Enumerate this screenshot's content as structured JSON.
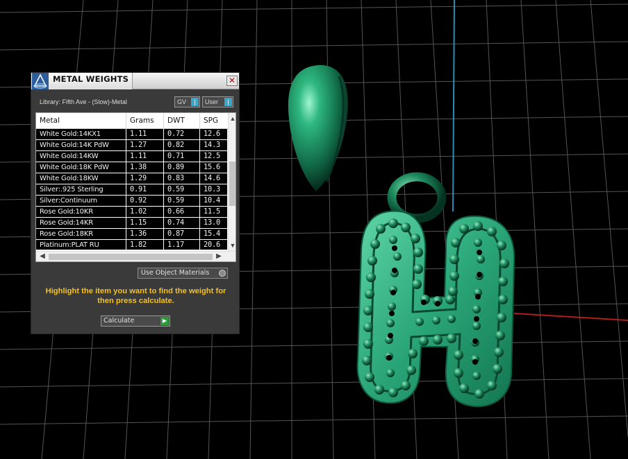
{
  "panel": {
    "title": "METAL WEIGHTS",
    "close_glyph": "✕",
    "library_label": "Library: Fifth Ave - (Slow)-Metal",
    "gv_label": "GV",
    "user_label": "User",
    "toggle_glyph": "|",
    "columns": [
      "Metal",
      "Grams",
      "DWT",
      "SPG"
    ],
    "rows": [
      {
        "metal": "White Gold:14KX1",
        "grams": "1.11",
        "dwt": "0.72",
        "spg": "12.6"
      },
      {
        "metal": "White Gold:14K PdW",
        "grams": "1.27",
        "dwt": "0.82",
        "spg": "14.3"
      },
      {
        "metal": "White Gold:14KW",
        "grams": "1.11",
        "dwt": "0.71",
        "spg": "12.5"
      },
      {
        "metal": "White Gold:18K PdW",
        "grams": "1.38",
        "dwt": "0.89",
        "spg": "15.6"
      },
      {
        "metal": "White Gold:18KW",
        "grams": "1.29",
        "dwt": "0.83",
        "spg": "14.6"
      },
      {
        "metal": "Silver:.925 Sterling",
        "grams": "0.91",
        "dwt": "0.59",
        "spg": "10.3"
      },
      {
        "metal": "Silver:Continuum",
        "grams": "0.92",
        "dwt": "0.59",
        "spg": "10.4"
      },
      {
        "metal": "Rose Gold:10KR",
        "grams": "1.02",
        "dwt": "0.66",
        "spg": "11.5"
      },
      {
        "metal": "Rose Gold:14KR",
        "grams": "1.15",
        "dwt": "0.74",
        "spg": "13.0"
      },
      {
        "metal": "Rose Gold:18KR",
        "grams": "1.36",
        "dwt": "0.87",
        "spg": "15.4"
      },
      {
        "metal": "Platinum:PLAT RU",
        "grams": "1.82",
        "dwt": "1.17",
        "spg": "20.6"
      }
    ],
    "scroll_up": "▲",
    "scroll_down": "▼",
    "scroll_left": "◀",
    "scroll_right": "▶",
    "use_object_materials": "Use Object Materials",
    "instructions": "Highlight the item you want to find the weight for then press calculate.",
    "calculate_label": "Calculate",
    "calculate_glyph": "▶"
  },
  "colors": {
    "model_green": "#1f8a5e",
    "instruction_yellow": "#f5c022",
    "axis_blue": "#2a8fb5",
    "axis_red": "#b01e1e",
    "grid": "#5a5a5a"
  },
  "icons": [
    "app-logo-icon",
    "close-icon",
    "toggle-icon",
    "play-icon",
    "scroll-arrow-icon"
  ]
}
